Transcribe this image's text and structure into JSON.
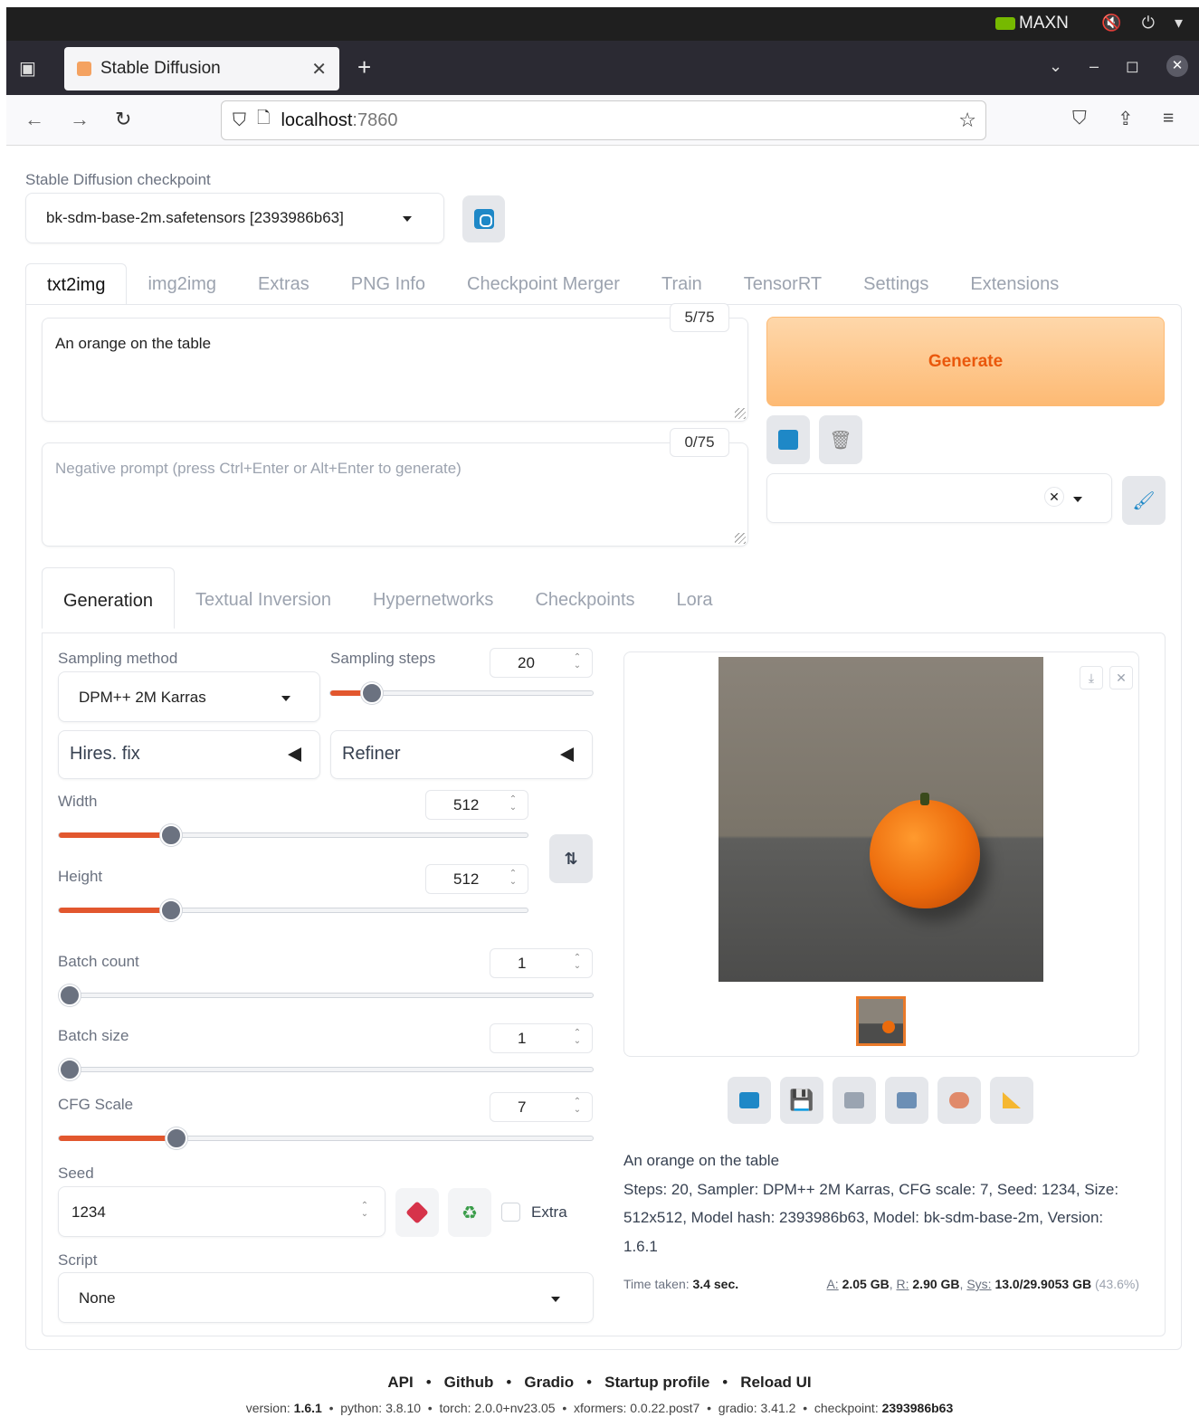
{
  "system": {
    "power_mode": "MAXN"
  },
  "browser": {
    "tab_title": "Stable Diffusion",
    "url_host": "localhost",
    "url_port": ":7860"
  },
  "checkpoint": {
    "label": "Stable Diffusion checkpoint",
    "value": "bk-sdm-base-2m.safetensors [2393986b63]"
  },
  "main_tabs": [
    "txt2img",
    "img2img",
    "Extras",
    "PNG Info",
    "Checkpoint Merger",
    "Train",
    "TensorRT",
    "Settings",
    "Extensions"
  ],
  "prompt": {
    "text": "An orange on the table",
    "counter": "5/75"
  },
  "negative_prompt": {
    "placeholder": "Negative prompt (press Ctrl+Enter or Alt+Enter to generate)",
    "counter": "0/75"
  },
  "generate_label": "Generate",
  "sub_tabs": [
    "Generation",
    "Textual Inversion",
    "Hypernetworks",
    "Checkpoints",
    "Lora"
  ],
  "params": {
    "sampling_method_label": "Sampling method",
    "sampling_method": "DPM++ 2M Karras",
    "sampling_steps_label": "Sampling steps",
    "sampling_steps": "20",
    "sampling_steps_fraction": 0.16,
    "hires_fix": "Hires. fix",
    "refiner": "Refiner",
    "width_label": "Width",
    "width": "512",
    "width_fraction": 0.24,
    "height_label": "Height",
    "height": "512",
    "height_fraction": 0.24,
    "batch_count_label": "Batch count",
    "batch_count": "1",
    "batch_size_label": "Batch size",
    "batch_size": "1",
    "cfg_label": "CFG Scale",
    "cfg": "7",
    "cfg_fraction": 0.22,
    "seed_label": "Seed",
    "seed": "1234",
    "extra_label": "Extra",
    "script_label": "Script",
    "script": "None"
  },
  "output": {
    "prompt_line": "An orange on the table",
    "details": "Steps: 20, Sampler: DPM++ 2M Karras, CFG scale: 7, Seed: 1234, Size: 512x512, Model hash: 2393986b63, Model: bk-sdm-base-2m, Version: 1.6.1",
    "time_label": "Time taken:",
    "time_value": "3.4 sec.",
    "mem_a_label": "A:",
    "mem_a": "2.05 GB",
    "mem_r_label": "R:",
    "mem_r": "2.90 GB",
    "mem_sys_label": "Sys:",
    "mem_sys": "13.0/29.9053 GB",
    "mem_pct": "(43.6%)"
  },
  "footer": {
    "links": [
      "API",
      "Github",
      "Gradio",
      "Startup profile",
      "Reload UI"
    ],
    "version_label": "version:",
    "version": "1.6.1",
    "python_label": "python:",
    "python": "3.8.10",
    "torch_label": "torch:",
    "torch": "2.0.0+nv23.05",
    "xformers_label": "xformers:",
    "xformers": "0.0.22.post7",
    "gradio_label": "gradio:",
    "gradio": "3.41.2",
    "checkpoint_label": "checkpoint:",
    "checkpoint": "2393986b63"
  }
}
